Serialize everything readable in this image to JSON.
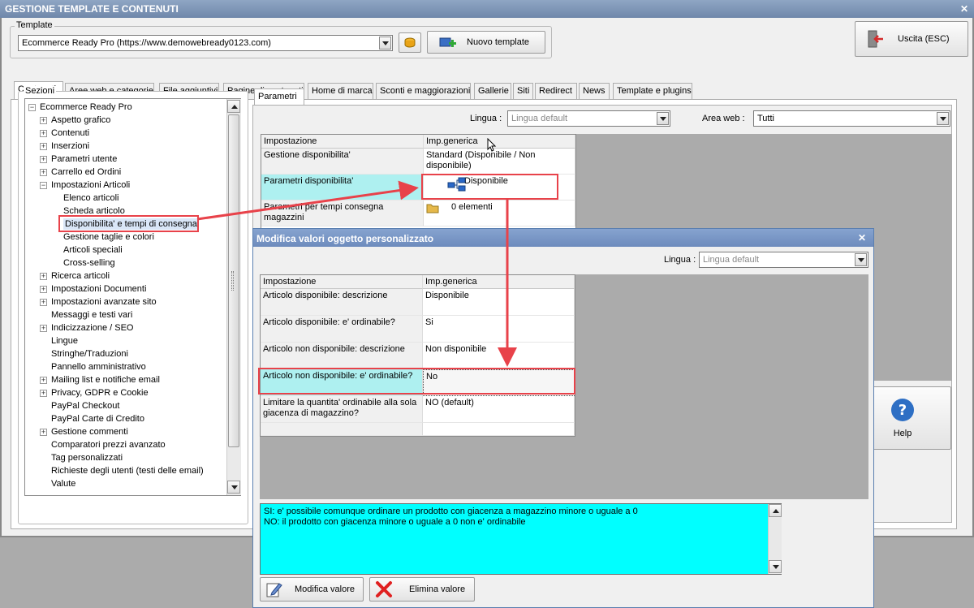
{
  "window": {
    "title": "GESTIONE TEMPLATE E CONTENUTI",
    "close": "✕"
  },
  "template_group": {
    "label": "Template",
    "selected": "Ecommerce Ready Pro (https://www.demowebready0123.com)",
    "new_button": "Nuovo template"
  },
  "exit_button": "Uscita (ESC)",
  "help_button": "Help",
  "tabs": [
    "Contenuti",
    "Aree web e categorie",
    "File aggiuntivi",
    "Pagine di contenuti",
    "Home di marca",
    "Sconti e maggiorazioni",
    "Gallerie",
    "Siti",
    "Redirect",
    "News",
    "Template e plugins"
  ],
  "sections": {
    "label": "Sezioni",
    "items": [
      {
        "label": "Ecommerce Ready Pro",
        "level": 0,
        "exp": "minus"
      },
      {
        "label": "Aspetto grafico",
        "level": 1,
        "exp": "plus"
      },
      {
        "label": "Contenuti",
        "level": 1,
        "exp": "plus"
      },
      {
        "label": "Inserzioni",
        "level": 1,
        "exp": "plus"
      },
      {
        "label": "Parametri utente",
        "level": 1,
        "exp": "plus"
      },
      {
        "label": "Carrello ed Ordini",
        "level": 1,
        "exp": "plus"
      },
      {
        "label": "Impostazioni Articoli",
        "level": 1,
        "exp": "minus"
      },
      {
        "label": "Elenco articoli",
        "level": 2,
        "exp": ""
      },
      {
        "label": "Scheda articolo",
        "level": 2,
        "exp": ""
      },
      {
        "label": "Disponibilita' e tempi di consegna",
        "level": 2,
        "exp": "",
        "selected": true
      },
      {
        "label": "Gestione taglie e colori",
        "level": 2,
        "exp": ""
      },
      {
        "label": "Articoli speciali",
        "level": 2,
        "exp": ""
      },
      {
        "label": "Cross-selling",
        "level": 2,
        "exp": ""
      },
      {
        "label": "Ricerca articoli",
        "level": 1,
        "exp": "plus"
      },
      {
        "label": "Impostazioni Documenti",
        "level": 1,
        "exp": "plus"
      },
      {
        "label": "Impostazioni avanzate sito",
        "level": 1,
        "exp": "plus"
      },
      {
        "label": "Messaggi e testi vari",
        "level": 1,
        "exp": ""
      },
      {
        "label": "Indicizzazione / SEO",
        "level": 1,
        "exp": "plus"
      },
      {
        "label": "Lingue",
        "level": 1,
        "exp": ""
      },
      {
        "label": "Stringhe/Traduzioni",
        "level": 1,
        "exp": ""
      },
      {
        "label": "Pannello amministrativo",
        "level": 1,
        "exp": ""
      },
      {
        "label": "Mailing list e notifiche email",
        "level": 1,
        "exp": "plus"
      },
      {
        "label": "Privacy, GDPR e Cookie",
        "level": 1,
        "exp": "plus"
      },
      {
        "label": "PayPal Checkout",
        "level": 1,
        "exp": ""
      },
      {
        "label": "PayPal Carte di Credito",
        "level": 1,
        "exp": ""
      },
      {
        "label": "Gestione commenti",
        "level": 1,
        "exp": "plus"
      },
      {
        "label": "Comparatori prezzi avanzato",
        "level": 1,
        "exp": ""
      },
      {
        "label": "Tag personalizzati",
        "level": 1,
        "exp": ""
      },
      {
        "label": "Richieste degli utenti (testi delle email)",
        "level": 1,
        "exp": ""
      },
      {
        "label": "Valute",
        "level": 1,
        "exp": ""
      }
    ]
  },
  "params": {
    "tab": "Parametri",
    "lingua_label": "Lingua :",
    "lingua_value": "Lingua default",
    "area_label": "Area web :",
    "area_value": "Tutti",
    "col1": "Impostazione",
    "col2": "Imp.generica",
    "rows": [
      {
        "name": "Gestione disponibilita'",
        "value": "Standard (Disponibile / Non disponibile)"
      },
      {
        "name": "Parametri disponibilita'",
        "value": "Disponibile"
      },
      {
        "name": "Parametri per tempi consegna magazzini",
        "value": "0 elementi"
      }
    ]
  },
  "dialog": {
    "title": "Modifica valori oggetto personalizzato",
    "close": "✕",
    "lingua_label": "Lingua :",
    "lingua_value": "Lingua default",
    "col1": "Impostazione",
    "col2": "Imp.generica",
    "rows": [
      {
        "name": "Articolo disponibile: descrizione",
        "value": "Disponibile"
      },
      {
        "name": "Articolo disponibile: e' ordinabile?",
        "value": "Si"
      },
      {
        "name": "Articolo non disponibile: descrizione",
        "value": "Non disponibile"
      },
      {
        "name": "Articolo non disponibile: e' ordinabile?",
        "value": "No"
      },
      {
        "name": "Limitare la quantita' ordinabile alla sola giacenza di magazzino?",
        "value": "NO (default)"
      }
    ],
    "help_line1": "SI: e' possibile comunque ordinare un prodotto con giacenza a magazzino minore o uguale a 0",
    "help_line2": "NO: il prodotto con giacenza minore o uguale a 0 non e' ordinabile",
    "edit_button": "Modifica valore",
    "delete_button": "Elimina valore"
  },
  "colors": {
    "highlight": "#e8424a",
    "selected_row": "#aef0f0",
    "help_bg": "#00ffff"
  }
}
